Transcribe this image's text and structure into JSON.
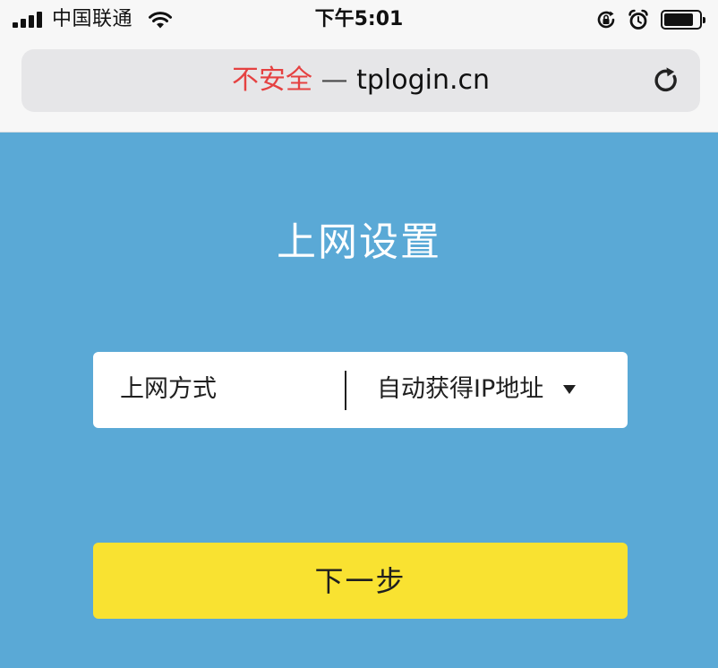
{
  "status_bar": {
    "carrier": "中国联通",
    "time": "下午5:01",
    "battery_level": 0.85
  },
  "address_bar": {
    "security_label": "不安全",
    "separator": "—",
    "domain": "tplogin.cn"
  },
  "page": {
    "title": "上网设置",
    "connection_field": {
      "label": "上网方式",
      "selected_value": "自动获得IP地址"
    },
    "next_button_label": "下一步"
  },
  "colors": {
    "page_background": "#5aa9d6",
    "button_yellow": "#f9e231",
    "insecure_red": "#e54141",
    "chrome_background": "#f7f7f7",
    "address_bar_background": "#e6e6e8"
  },
  "icons": {
    "signal": "signal-strength-icon",
    "wifi": "wifi-icon",
    "rotation_lock": "rotation-lock-icon",
    "alarm": "alarm-clock-icon",
    "battery": "battery-icon",
    "reload": "reload-icon",
    "dropdown": "dropdown-arrow-icon"
  }
}
